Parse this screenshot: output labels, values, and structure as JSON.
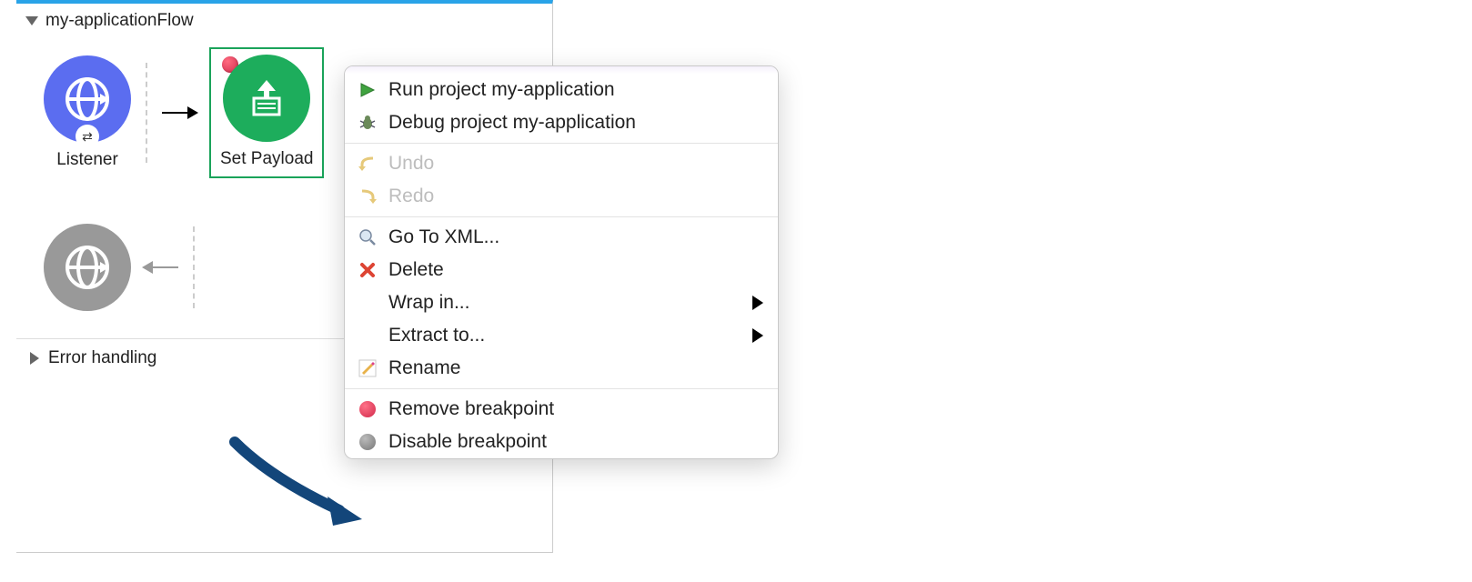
{
  "flow": {
    "title": "my-applicationFlow",
    "listener_label": "Listener",
    "set_payload_label": "Set Payload",
    "error_section": "Error handling"
  },
  "menu": {
    "run": "Run project my-application",
    "debug": "Debug project my-application",
    "undo": "Undo",
    "redo": "Redo",
    "goto_xml": "Go To XML...",
    "delete": "Delete",
    "wrap_in": "Wrap in...",
    "extract_to": "Extract to...",
    "rename": "Rename",
    "remove_bp": "Remove breakpoint",
    "disable_bp": "Disable breakpoint"
  }
}
